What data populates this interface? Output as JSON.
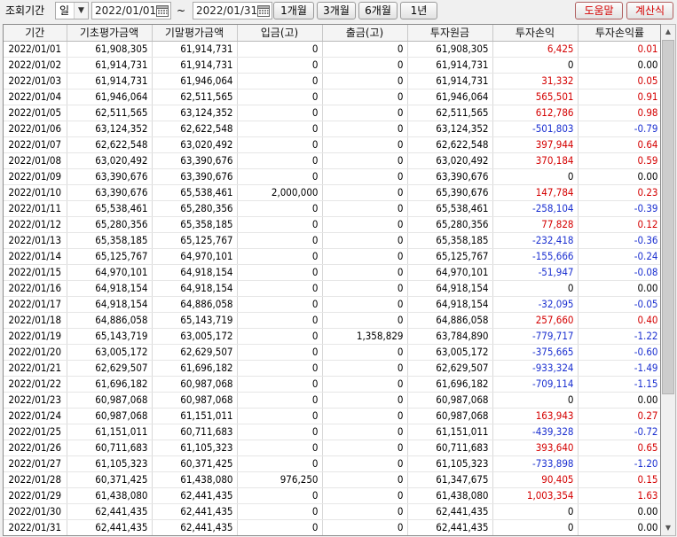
{
  "toolbar": {
    "period_label": "조회기간",
    "unit_value": "일",
    "start_date": "2022/01/01",
    "tilde": "~",
    "end_date": "2022/01/31",
    "btn_1m": "1개월",
    "btn_3m": "3개월",
    "btn_6m": "6개월",
    "btn_1y": "1년",
    "btn_help": "도움말",
    "btn_calc": "계산식"
  },
  "table": {
    "headers": [
      "기간",
      "기초평가금액",
      "기말평가금액",
      "입금(고)",
      "출금(고)",
      "투자원금",
      "투자손익",
      "투자손익률"
    ],
    "rows": [
      [
        "2022/01/01",
        "61,908,305",
        "61,914,731",
        "0",
        "0",
        "61,908,305",
        "6,425",
        "0.01"
      ],
      [
        "2022/01/02",
        "61,914,731",
        "61,914,731",
        "0",
        "0",
        "61,914,731",
        "0",
        "0.00"
      ],
      [
        "2022/01/03",
        "61,914,731",
        "61,946,064",
        "0",
        "0",
        "61,914,731",
        "31,332",
        "0.05"
      ],
      [
        "2022/01/04",
        "61,946,064",
        "62,511,565",
        "0",
        "0",
        "61,946,064",
        "565,501",
        "0.91"
      ],
      [
        "2022/01/05",
        "62,511,565",
        "63,124,352",
        "0",
        "0",
        "62,511,565",
        "612,786",
        "0.98"
      ],
      [
        "2022/01/06",
        "63,124,352",
        "62,622,548",
        "0",
        "0",
        "63,124,352",
        "-501,803",
        "-0.79"
      ],
      [
        "2022/01/07",
        "62,622,548",
        "63,020,492",
        "0",
        "0",
        "62,622,548",
        "397,944",
        "0.64"
      ],
      [
        "2022/01/08",
        "63,020,492",
        "63,390,676",
        "0",
        "0",
        "63,020,492",
        "370,184",
        "0.59"
      ],
      [
        "2022/01/09",
        "63,390,676",
        "63,390,676",
        "0",
        "0",
        "63,390,676",
        "0",
        "0.00"
      ],
      [
        "2022/01/10",
        "63,390,676",
        "65,538,461",
        "2,000,000",
        "0",
        "65,390,676",
        "147,784",
        "0.23"
      ],
      [
        "2022/01/11",
        "65,538,461",
        "65,280,356",
        "0",
        "0",
        "65,538,461",
        "-258,104",
        "-0.39"
      ],
      [
        "2022/01/12",
        "65,280,356",
        "65,358,185",
        "0",
        "0",
        "65,280,356",
        "77,828",
        "0.12"
      ],
      [
        "2022/01/13",
        "65,358,185",
        "65,125,767",
        "0",
        "0",
        "65,358,185",
        "-232,418",
        "-0.36"
      ],
      [
        "2022/01/14",
        "65,125,767",
        "64,970,101",
        "0",
        "0",
        "65,125,767",
        "-155,666",
        "-0.24"
      ],
      [
        "2022/01/15",
        "64,970,101",
        "64,918,154",
        "0",
        "0",
        "64,970,101",
        "-51,947",
        "-0.08"
      ],
      [
        "2022/01/16",
        "64,918,154",
        "64,918,154",
        "0",
        "0",
        "64,918,154",
        "0",
        "0.00"
      ],
      [
        "2022/01/17",
        "64,918,154",
        "64,886,058",
        "0",
        "0",
        "64,918,154",
        "-32,095",
        "-0.05"
      ],
      [
        "2022/01/18",
        "64,886,058",
        "65,143,719",
        "0",
        "0",
        "64,886,058",
        "257,660",
        "0.40"
      ],
      [
        "2022/01/19",
        "65,143,719",
        "63,005,172",
        "0",
        "1,358,829",
        "63,784,890",
        "-779,717",
        "-1.22"
      ],
      [
        "2022/01/20",
        "63,005,172",
        "62,629,507",
        "0",
        "0",
        "63,005,172",
        "-375,665",
        "-0.60"
      ],
      [
        "2022/01/21",
        "62,629,507",
        "61,696,182",
        "0",
        "0",
        "62,629,507",
        "-933,324",
        "-1.49"
      ],
      [
        "2022/01/22",
        "61,696,182",
        "60,987,068",
        "0",
        "0",
        "61,696,182",
        "-709,114",
        "-1.15"
      ],
      [
        "2022/01/23",
        "60,987,068",
        "60,987,068",
        "0",
        "0",
        "60,987,068",
        "0",
        "0.00"
      ],
      [
        "2022/01/24",
        "60,987,068",
        "61,151,011",
        "0",
        "0",
        "60,987,068",
        "163,943",
        "0.27"
      ],
      [
        "2022/01/25",
        "61,151,011",
        "60,711,683",
        "0",
        "0",
        "61,151,011",
        "-439,328",
        "-0.72"
      ],
      [
        "2022/01/26",
        "60,711,683",
        "61,105,323",
        "0",
        "0",
        "60,711,683",
        "393,640",
        "0.65"
      ],
      [
        "2022/01/27",
        "61,105,323",
        "60,371,425",
        "0",
        "0",
        "61,105,323",
        "-733,898",
        "-1.20"
      ],
      [
        "2022/01/28",
        "60,371,425",
        "61,438,080",
        "976,250",
        "0",
        "61,347,675",
        "90,405",
        "0.15"
      ],
      [
        "2022/01/29",
        "61,438,080",
        "62,441,435",
        "0",
        "0",
        "61,438,080",
        "1,003,354",
        "1.63"
      ],
      [
        "2022/01/30",
        "62,441,435",
        "62,441,435",
        "0",
        "0",
        "62,441,435",
        "0",
        "0.00"
      ],
      [
        "2022/01/31",
        "62,441,435",
        "62,441,435",
        "0",
        "0",
        "62,441,435",
        "0",
        "0.00"
      ]
    ]
  },
  "colors": {
    "positive": "#d40000",
    "negative": "#1a2fd0",
    "accent_button_text": "#d40000"
  },
  "icons": {
    "calendar": "calendar-icon",
    "dropdown": "chevron-down-icon",
    "scroll_up": "arrow-up-icon",
    "scroll_down": "arrow-down-icon"
  }
}
